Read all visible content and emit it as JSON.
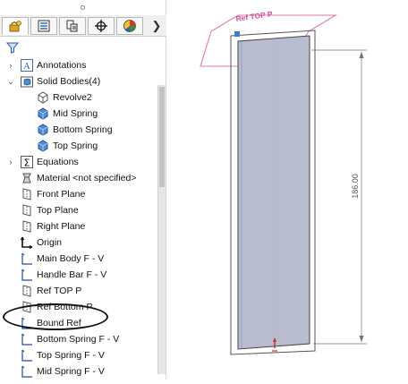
{
  "tabs": [
    {
      "name": "feature-manager-tab",
      "active": true
    },
    {
      "name": "property-manager-tab",
      "active": false
    },
    {
      "name": "configuration-manager-tab",
      "active": false
    },
    {
      "name": "dimxpert-tab",
      "active": false
    },
    {
      "name": "display-manager-tab",
      "active": false
    }
  ],
  "tree": {
    "annotations": "Annotations",
    "solid_bodies": "Solid Bodies(4)",
    "revolve2": "Revolve2",
    "mid_spring": "Mid Spring",
    "bottom_spring": "Bottom Spring",
    "top_spring": "Top Spring",
    "equations": "Equations",
    "material": "Material <not specified>",
    "front_plane": "Front Plane",
    "top_plane": "Top Plane",
    "right_plane": "Right Plane",
    "origin": "Origin",
    "main_body": "Main Body F - V",
    "handle_bar": "Handle Bar F - V",
    "ref_top_p": "Ref TOP P",
    "ref_bottom_p": "Ref Bottom P",
    "bound_ref": "Bound Ref",
    "bottom_spring_fv": "Bottom Spring F - V",
    "top_spring_fv": "Top Spring F - V",
    "mid_spring_fv": "Mid Spring F - V"
  },
  "viewport": {
    "plane_label": "Ref TOP P",
    "dimension": "186.00"
  },
  "colors": {
    "plane": "#e07ab0",
    "body": "#b9bccf",
    "tab_border": "#b7b7b7",
    "dim_line": "#707070"
  }
}
